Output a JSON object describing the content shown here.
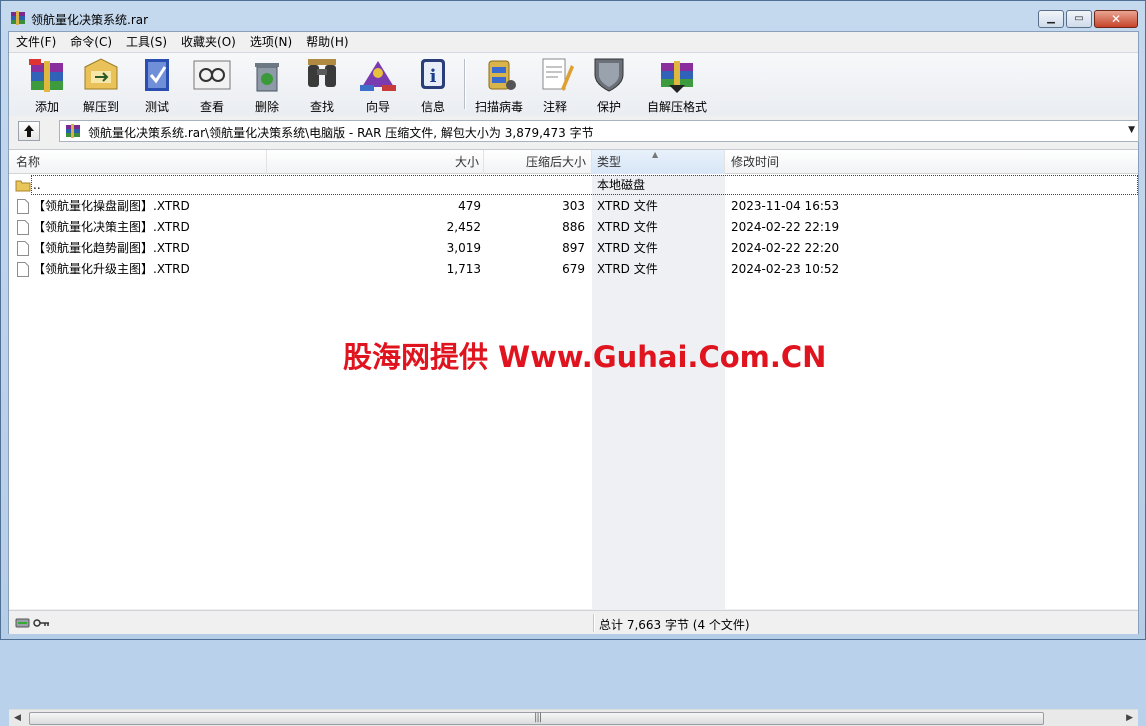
{
  "window": {
    "title": "领航量化决策系统.rar",
    "minimize_icon": "minimize-icon",
    "maximize_icon": "maximize-icon",
    "close_icon": "close-icon"
  },
  "menu": [
    "文件(F)",
    "命令(C)",
    "工具(S)",
    "收藏夹(O)",
    "选项(N)",
    "帮助(H)"
  ],
  "toolbar": [
    {
      "label": "添加",
      "icon": "add-archive-icon"
    },
    {
      "label": "解压到",
      "icon": "extract-to-icon"
    },
    {
      "label": "测试",
      "icon": "test-icon"
    },
    {
      "label": "查看",
      "icon": "view-icon"
    },
    {
      "label": "删除",
      "icon": "delete-icon"
    },
    {
      "label": "查找",
      "icon": "find-icon"
    },
    {
      "label": "向导",
      "icon": "wizard-icon"
    },
    {
      "label": "信息",
      "icon": "info-icon"
    },
    {
      "label": "扫描病毒",
      "icon": "scan-virus-icon"
    },
    {
      "label": "注释",
      "icon": "comment-icon"
    },
    {
      "label": "保护",
      "icon": "protect-icon"
    },
    {
      "label": "自解压格式",
      "icon": "sfx-icon"
    }
  ],
  "address": {
    "path": "领航量化决策系统.rar\\领航量化决策系统\\电脑版 - RAR 压缩文件, 解包大小为 3,879,473 字节"
  },
  "columns": {
    "name": "名称",
    "size": "大小",
    "packed": "压缩后大小",
    "type": "类型",
    "modified": "修改时间"
  },
  "parent_row": {
    "name": "..",
    "type": "本地磁盘"
  },
  "files": [
    {
      "name": "【领航量化操盘副图】.XTRD",
      "size": "479",
      "packed": "303",
      "type": "XTRD 文件",
      "modified": "2023-11-04 16:53"
    },
    {
      "name": "【领航量化决策主图】.XTRD",
      "size": "2,452",
      "packed": "886",
      "type": "XTRD 文件",
      "modified": "2024-02-22 22:19"
    },
    {
      "name": "【领航量化趋势副图】.XTRD",
      "size": "3,019",
      "packed": "897",
      "type": "XTRD 文件",
      "modified": "2024-02-22 22:20"
    },
    {
      "name": "【领航量化升级主图】.XTRD",
      "size": "1,713",
      "packed": "679",
      "type": "XTRD 文件",
      "modified": "2024-02-23 10:52"
    }
  ],
  "watermark": "股海网提供 Www.Guhai.Com.CN",
  "status": {
    "text": "总计 7,663 字节 (4 个文件)"
  },
  "colors": {
    "watermark": "#e0141f",
    "type_column_bg": "#eef0f4"
  }
}
